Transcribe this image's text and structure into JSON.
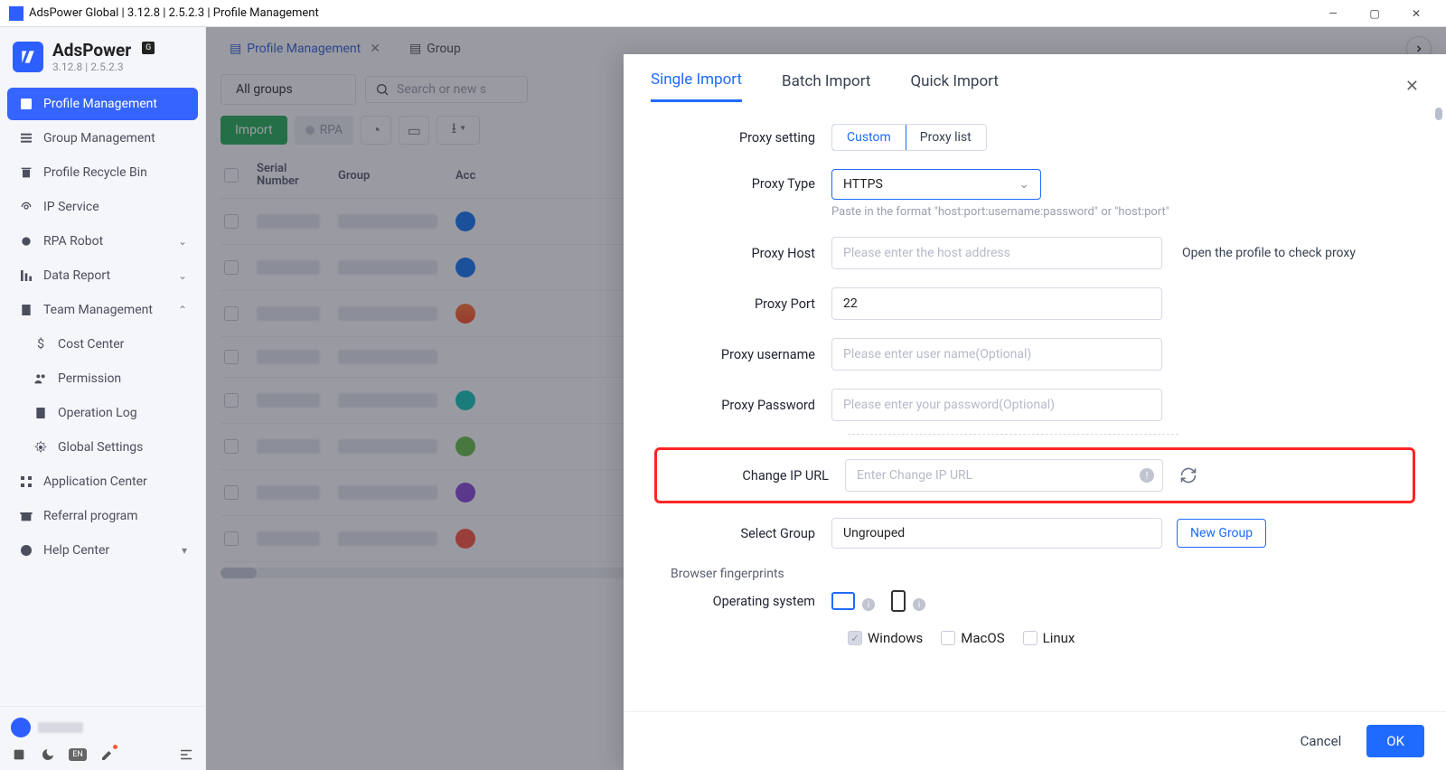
{
  "window": {
    "title": "AdsPower Global | 3.12.8 | 2.5.2.3 | Profile Management"
  },
  "brand": {
    "name": "AdsPower",
    "version": "3.12.8  |  2.5.2.3",
    "badge": "G"
  },
  "sidebar": {
    "items": [
      {
        "label": "Profile Management"
      },
      {
        "label": "Group Management"
      },
      {
        "label": "Profile Recycle Bin"
      },
      {
        "label": "IP Service"
      },
      {
        "label": "RPA Robot"
      },
      {
        "label": "Data Report"
      },
      {
        "label": "Team Management"
      },
      {
        "label": "Cost Center"
      },
      {
        "label": "Permission"
      },
      {
        "label": "Operation Log"
      },
      {
        "label": "Global Settings"
      },
      {
        "label": "Application Center"
      },
      {
        "label": "Referral program"
      },
      {
        "label": "Help Center"
      }
    ]
  },
  "tabs": {
    "t0": "Profile Management",
    "t1": "Group"
  },
  "toolbar": {
    "all_groups": "All groups",
    "search_placeholder": "Search or new s",
    "import": "Import",
    "rpa": "RPA"
  },
  "table": {
    "col_sn": "Serial Number",
    "col_group": "Group",
    "col_acc": "Acc"
  },
  "drawer": {
    "tabs": {
      "single": "Single Import",
      "batch": "Batch Import",
      "quick": "Quick Import"
    },
    "labels": {
      "proxy_setting": "Proxy setting",
      "proxy_type": "Proxy Type",
      "proxy_host": "Proxy Host",
      "proxy_port": "Proxy Port",
      "proxy_user": "Proxy username",
      "proxy_pass": "Proxy Password",
      "change_ip": "Change IP URL",
      "select_group": "Select Group",
      "browser_fp": "Browser fingerprints",
      "os": "Operating system"
    },
    "opts": {
      "custom": "Custom",
      "proxy_list": "Proxy list"
    },
    "values": {
      "proxy_type": "HTTPS",
      "proxy_port": "22",
      "group": "Ungrouped"
    },
    "placeholders": {
      "host": "Please enter the host address",
      "user": "Please enter user name(Optional)",
      "pass": "Please enter your password(Optional)",
      "change_ip": "Enter Change IP URL"
    },
    "hints": {
      "paste": "Paste in the format \"host:port:username:password\" or \"host:port\"",
      "open_profile": "Open the profile to check proxy"
    },
    "buttons": {
      "new_group": "New Group",
      "cancel": "Cancel",
      "ok": "OK"
    },
    "os_opts": {
      "win": "Windows",
      "mac": "MacOS",
      "lin": "Linux"
    }
  }
}
